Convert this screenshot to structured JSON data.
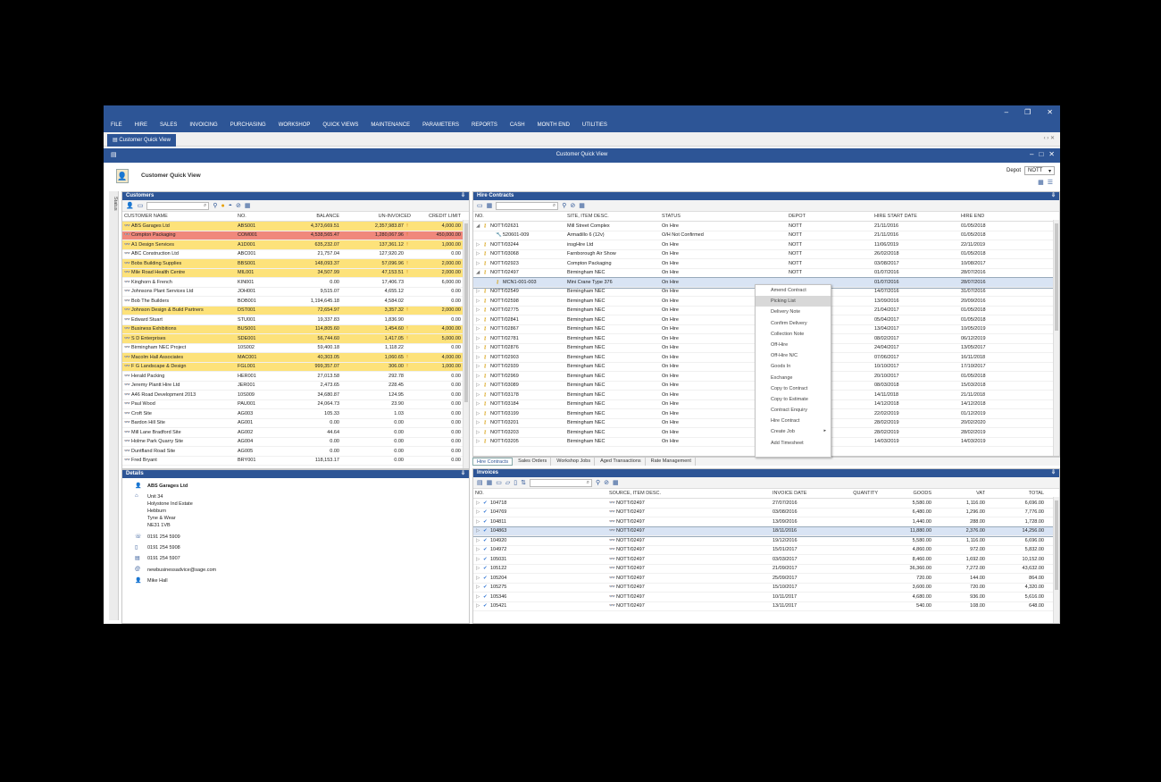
{
  "menu": [
    "FILE",
    "HIRE",
    "SALES",
    "INVOICING",
    "PURCHASING",
    "WORKSHOP",
    "QUICK VIEWS",
    "MAINTENANCE",
    "PARAMETERS",
    "REPORTS",
    "CASH",
    "MONTH END",
    "UTILITIES"
  ],
  "doc_tab": "Customer Quick View",
  "qv_title": "Customer Quick View",
  "page_title": "Customer Quick View",
  "depot_label": "Depot",
  "depot_value": "NOTT",
  "side_tab": "Status",
  "customers": {
    "title": "Customers",
    "columns": [
      "CUSTOMER NAME",
      "NO.",
      "BALANCE",
      "UN-INVOICED",
      "CREDIT LIMIT"
    ],
    "rows": [
      {
        "name": "ABS Garages Ltd",
        "no": "ABS001",
        "balance": "4,373,669.51",
        "uninv": "2,357,983.87",
        "limit": "4,000.00",
        "hl": "yel",
        "flag": "!"
      },
      {
        "name": "Compton Packaging",
        "no": "COM001",
        "balance": "4,538,565.47",
        "uninv": "1,280,067.96",
        "limit": "450,000.00",
        "hl": "red",
        "flag": "!"
      },
      {
        "name": "A1 Design Services",
        "no": "A1D001",
        "balance": "635,232.07",
        "uninv": "137,361.12",
        "limit": "1,000.00",
        "hl": "yel",
        "flag": "!"
      },
      {
        "name": "ABC Construction Ltd",
        "no": "ABC001",
        "balance": "21,757.04",
        "uninv": "127,920.20",
        "limit": "0.00",
        "hl": "",
        "flag": ""
      },
      {
        "name": "Bobs Building Supplies",
        "no": "BBS001",
        "balance": "148,093.37",
        "uninv": "57,096.96",
        "limit": "2,000.00",
        "hl": "yel",
        "flag": "!"
      },
      {
        "name": "Mile Road Health Centre",
        "no": "MIL001",
        "balance": "34,507.99",
        "uninv": "47,153.51",
        "limit": "2,000.00",
        "hl": "yel",
        "flag": "!"
      },
      {
        "name": "Kinghorn & French",
        "no": "KIN001",
        "balance": "0.00",
        "uninv": "17,406.73",
        "limit": "6,000.00",
        "hl": "",
        "flag": ""
      },
      {
        "name": "Johnsons Plant Services Ltd",
        "no": "JOH001",
        "balance": "9,515.07",
        "uninv": "4,655.12",
        "limit": "0.00",
        "hl": "",
        "flag": ""
      },
      {
        "name": "Bob The Builders",
        "no": "BOB001",
        "balance": "1,194,645.18",
        "uninv": "4,584.02",
        "limit": "0.00",
        "hl": "",
        "flag": ""
      },
      {
        "name": "Johnson Design & Build Partners",
        "no": "DST001",
        "balance": "72,654.97",
        "uninv": "3,357.32",
        "limit": "2,000.00",
        "hl": "yel",
        "flag": "!"
      },
      {
        "name": "Edward Stuart",
        "no": "STU001",
        "balance": "19,337.83",
        "uninv": "1,836.90",
        "limit": "0.00",
        "hl": "",
        "flag": ""
      },
      {
        "name": "Business Exhibitions",
        "no": "BUS001",
        "balance": "114,805.60",
        "uninv": "1,454.60",
        "limit": "4,000.00",
        "hl": "yel",
        "flag": "!"
      },
      {
        "name": "S D Enterprises",
        "no": "SDE001",
        "balance": "56,744.60",
        "uninv": "1,417.05",
        "limit": "5,000.00",
        "hl": "yel",
        "flag": "!"
      },
      {
        "name": "Birmingham NEC Project",
        "no": "10S002",
        "balance": "59,400.18",
        "uninv": "1,118.22",
        "limit": "0.00",
        "hl": "",
        "flag": ""
      },
      {
        "name": "Macolm Hall Associates",
        "no": "MAC001",
        "balance": "40,303.05",
        "uninv": "1,060.65",
        "limit": "4,000.00",
        "hl": "yel",
        "flag": "!"
      },
      {
        "name": "F G Landscape & Design",
        "no": "FGL001",
        "balance": "999,357.07",
        "uninv": "306.00",
        "limit": "1,000.00",
        "hl": "yel",
        "flag": "!"
      },
      {
        "name": "Herald Packing",
        "no": "HER001",
        "balance": "27,013.58",
        "uninv": "292.78",
        "limit": "0.00",
        "hl": "",
        "flag": ""
      },
      {
        "name": "Jeremy Plantt Hire Ltd",
        "no": "JER001",
        "balance": "2,473.65",
        "uninv": "228.45",
        "limit": "0.00",
        "hl": "",
        "flag": ""
      },
      {
        "name": "A46 Road Development 2013",
        "no": "10S009",
        "balance": "34,680.87",
        "uninv": "124.95",
        "limit": "0.00",
        "hl": "",
        "flag": ""
      },
      {
        "name": "Paul Wood",
        "no": "PAU001",
        "balance": "24,064.73",
        "uninv": "23.90",
        "limit": "0.00",
        "hl": "",
        "flag": ""
      },
      {
        "name": "Croft Site",
        "no": "AG003",
        "balance": "105.33",
        "uninv": "1.03",
        "limit": "0.00",
        "hl": "",
        "flag": ""
      },
      {
        "name": "Bardon Hill Site",
        "no": "AG001",
        "balance": "0.00",
        "uninv": "0.00",
        "limit": "0.00",
        "hl": "",
        "flag": ""
      },
      {
        "name": "Mill Lane Bradford Site",
        "no": "AG002",
        "balance": "44.64",
        "uninv": "0.00",
        "limit": "0.00",
        "hl": "",
        "flag": ""
      },
      {
        "name": "Holme Park Quarry Site",
        "no": "AG004",
        "balance": "0.00",
        "uninv": "0.00",
        "limit": "0.00",
        "hl": "",
        "flag": ""
      },
      {
        "name": "Duntfland Road Site",
        "no": "AG005",
        "balance": "0.00",
        "uninv": "0.00",
        "limit": "0.00",
        "hl": "",
        "flag": ""
      },
      {
        "name": "Fred Bryant",
        "no": "BRY001",
        "balance": "118,153.17",
        "uninv": "0.00",
        "limit": "0.00",
        "hl": "",
        "flag": ""
      }
    ]
  },
  "details": {
    "title": "Details",
    "company": "ABS Garages Ltd",
    "address": [
      "Unit 34",
      "Holystone Ind Estate",
      "Hebburn",
      "Tyne & Wear",
      "NE31 1VB"
    ],
    "phone1": "0191 254 5909",
    "phone2": "0191 254 5908",
    "fax": "0191 254 5907",
    "email": "newbusinessadvice@sage.com",
    "contact": "Mike Hall"
  },
  "hire": {
    "title": "Hire Contracts",
    "columns": [
      "NO.",
      "SITE, ITEM DESC.",
      "STATUS",
      "DEPOT",
      "HIRE START DATE",
      "HIRE END"
    ],
    "rows": [
      {
        "no": "NOTT/02631",
        "site": "Mill Street Complex",
        "status": "On Hire",
        "depot": "NOTT",
        "start": "21/11/2016",
        "end": "01/05/2018",
        "exp": "◢",
        "icon": "key",
        "indent": 0,
        "sel": false
      },
      {
        "no": "520601-009",
        "site": "Armadillo 6 (12v)",
        "status": "O/H Not Confirmed",
        "depot": "NOTT",
        "start": "21/11/2016",
        "end": "01/05/2018",
        "exp": "",
        "icon": "tool",
        "indent": 1,
        "sel": false
      },
      {
        "no": "NOTT/03244",
        "site": "insgHire Ltd",
        "status": "On Hire",
        "depot": "NOTT",
        "start": "11/06/2019",
        "end": "22/11/2019",
        "exp": "▷",
        "icon": "key",
        "indent": 0,
        "sel": false
      },
      {
        "no": "NOTT/03068",
        "site": "Farnborough Air Show",
        "status": "On Hire",
        "depot": "NOTT",
        "start": "26/02/2018",
        "end": "01/05/2018",
        "exp": "▷",
        "icon": "key",
        "indent": 0,
        "sel": false
      },
      {
        "no": "NOTT/02923",
        "site": "Compton Packaging",
        "status": "On Hire",
        "depot": "NOTT",
        "start": "03/08/2017",
        "end": "10/08/2017",
        "exp": "▷",
        "icon": "key",
        "indent": 0,
        "sel": false
      },
      {
        "no": "NOTT/02497",
        "site": "Birmingham NEC",
        "status": "On Hire",
        "depot": "NOTT",
        "start": "01/07/2016",
        "end": "28/07/2016",
        "exp": "◢",
        "icon": "key",
        "indent": 0,
        "sel": false
      },
      {
        "no": "MCN1-001-003",
        "site": "Mini Crane Type 376",
        "status": "On Hire",
        "depot": "",
        "start": "01/07/2016",
        "end": "28/07/2016",
        "exp": "",
        "icon": "key",
        "indent": 1,
        "sel": true
      },
      {
        "no": "NOTT/02549",
        "site": "Birmingham NEC",
        "status": "On Hire",
        "depot": "",
        "start": "14/07/2016",
        "end": "31/07/2016",
        "exp": "▷",
        "icon": "key",
        "indent": 0,
        "sel": false
      },
      {
        "no": "NOTT/02598",
        "site": "Birmingham NEC",
        "status": "On Hire",
        "depot": "",
        "start": "13/09/2016",
        "end": "20/09/2016",
        "exp": "▷",
        "icon": "key",
        "indent": 0,
        "sel": false
      },
      {
        "no": "NOTT/02775",
        "site": "Birmingham NEC",
        "status": "On Hire",
        "depot": "",
        "start": "21/04/2017",
        "end": "01/05/2018",
        "exp": "▷",
        "icon": "key",
        "indent": 0,
        "sel": false
      },
      {
        "no": "NOTT/02841",
        "site": "Birmingham NEC",
        "status": "On Hire",
        "depot": "",
        "start": "05/04/2017",
        "end": "01/05/2018",
        "exp": "▷",
        "icon": "key",
        "indent": 0,
        "sel": false
      },
      {
        "no": "NOTT/02867",
        "site": "Birmingham NEC",
        "status": "On Hire",
        "depot": "",
        "start": "13/04/2017",
        "end": "10/05/2019",
        "exp": "▷",
        "icon": "key",
        "indent": 0,
        "sel": false
      },
      {
        "no": "NOTT/02781",
        "site": "Birmingham NEC",
        "status": "On Hire",
        "depot": "",
        "start": "08/02/2017",
        "end": "06/12/2019",
        "exp": "▷",
        "icon": "key",
        "indent": 0,
        "sel": false
      },
      {
        "no": "NOTT/02876",
        "site": "Birmingham NEC",
        "status": "On Hire",
        "depot": "",
        "start": "24/04/2017",
        "end": "13/05/2017",
        "exp": "▷",
        "icon": "key",
        "indent": 0,
        "sel": false
      },
      {
        "no": "NOTT/02903",
        "site": "Birmingham NEC",
        "status": "On Hire",
        "depot": "",
        "start": "07/06/2017",
        "end": "16/11/2018",
        "exp": "▷",
        "icon": "key",
        "indent": 0,
        "sel": false
      },
      {
        "no": "NOTT/02939",
        "site": "Birmingham NEC",
        "status": "On Hire",
        "depot": "",
        "start": "10/10/2017",
        "end": "17/10/2017",
        "exp": "▷",
        "icon": "key",
        "indent": 0,
        "sel": false
      },
      {
        "no": "NOTT/02969",
        "site": "Birmingham NEC",
        "status": "On Hire",
        "depot": "",
        "start": "20/10/2017",
        "end": "01/05/2018",
        "exp": "▷",
        "icon": "key",
        "indent": 0,
        "sel": false
      },
      {
        "no": "NOTT/03089",
        "site": "Birmingham NEC",
        "status": "On Hire",
        "depot": "",
        "start": "08/03/2018",
        "end": "15/03/2018",
        "exp": "▷",
        "icon": "key",
        "indent": 0,
        "sel": false
      },
      {
        "no": "NOTT/03178",
        "site": "Birmingham NEC",
        "status": "On Hire",
        "depot": "",
        "start": "14/11/2018",
        "end": "21/11/2018",
        "exp": "▷",
        "icon": "key",
        "indent": 0,
        "sel": false
      },
      {
        "no": "NOTT/03184",
        "site": "Birmingham NEC",
        "status": "On Hire",
        "depot": "",
        "start": "14/12/2018",
        "end": "14/12/2018",
        "exp": "▷",
        "icon": "key",
        "indent": 0,
        "sel": false
      },
      {
        "no": "NOTT/03199",
        "site": "Birmingham NEC",
        "status": "On Hire",
        "depot": "",
        "start": "22/02/2019",
        "end": "01/12/2019",
        "exp": "▷",
        "icon": "key",
        "indent": 0,
        "sel": false
      },
      {
        "no": "NOTT/03201",
        "site": "Birmingham NEC",
        "status": "On Hire",
        "depot": "",
        "start": "28/02/2019",
        "end": "20/02/2020",
        "exp": "▷",
        "icon": "key",
        "indent": 0,
        "sel": false
      },
      {
        "no": "NOTT/03203",
        "site": "Birmingham NEC",
        "status": "On Hire",
        "depot": "",
        "start": "28/02/2019",
        "end": "28/02/2019",
        "exp": "▷",
        "icon": "key",
        "indent": 0,
        "sel": false
      },
      {
        "no": "NOTT/03205",
        "site": "Birmingham NEC",
        "status": "On Hire",
        "depot": "",
        "start": "14/03/2019",
        "end": "14/03/2019",
        "exp": "▷",
        "icon": "key",
        "indent": 0,
        "sel": false
      }
    ]
  },
  "context_menu": [
    "Amend Contract",
    "Picking List",
    "Delivery Note",
    "Confirm Delivery",
    "Collection Note",
    "Off-Hire",
    "Off-Hire N/C",
    "Goods In",
    "Exchange",
    "Copy to Contract",
    "Copy to Estimate",
    "Contract Enquiry",
    "Hire Contract",
    "Create Job",
    "Add Timesheet"
  ],
  "context_highlight": 1,
  "bottom_tabs": [
    "Hire Contracts",
    "Sales Orders",
    "Workshop Jobs",
    "Aged Transactions",
    "Rate Management"
  ],
  "invoices": {
    "title": "Invoices",
    "columns": [
      "NO.",
      "SOURCE, ITEM DESC.",
      "INVOICE DATE",
      "QUANTITY",
      "GOODS",
      "VAT",
      "TOTAL"
    ],
    "rows": [
      {
        "no": "104718",
        "source": "NOTT/02497",
        "date": "27/07/2016",
        "goods": "5,580.00",
        "vat": "1,116.00",
        "total": "6,696.00",
        "sel": false
      },
      {
        "no": "104769",
        "source": "NOTT/02497",
        "date": "03/08/2016",
        "goods": "6,480.00",
        "vat": "1,296.00",
        "total": "7,776.00",
        "sel": false
      },
      {
        "no": "104811",
        "source": "NOTT/02497",
        "date": "13/09/2016",
        "goods": "1,440.00",
        "vat": "288.00",
        "total": "1,728.00",
        "sel": false
      },
      {
        "no": "104863",
        "source": "NOTT/02497",
        "date": "18/11/2016",
        "goods": "11,880.00",
        "vat": "2,376.00",
        "total": "14,256.00",
        "sel": true
      },
      {
        "no": "104920",
        "source": "NOTT/02497",
        "date": "19/12/2016",
        "goods": "5,580.00",
        "vat": "1,116.00",
        "total": "6,696.00",
        "sel": false
      },
      {
        "no": "104972",
        "source": "NOTT/02497",
        "date": "15/01/2017",
        "goods": "4,860.00",
        "vat": "972.00",
        "total": "5,832.00",
        "sel": false
      },
      {
        "no": "105031",
        "source": "NOTT/02497",
        "date": "03/03/2017",
        "goods": "8,460.00",
        "vat": "1,692.00",
        "total": "10,152.00",
        "sel": false
      },
      {
        "no": "105122",
        "source": "NOTT/02497",
        "date": "21/09/2017",
        "goods": "36,360.00",
        "vat": "7,272.00",
        "total": "43,632.00",
        "sel": false
      },
      {
        "no": "105204",
        "source": "NOTT/02497",
        "date": "25/09/2017",
        "goods": "720.00",
        "vat": "144.00",
        "total": "864.00",
        "sel": false
      },
      {
        "no": "105275",
        "source": "NOTT/02497",
        "date": "15/10/2017",
        "goods": "3,600.00",
        "vat": "720.00",
        "total": "4,320.00",
        "sel": false
      },
      {
        "no": "105346",
        "source": "NOTT/02497",
        "date": "10/11/2017",
        "goods": "4,680.00",
        "vat": "936.00",
        "total": "5,616.00",
        "sel": false
      },
      {
        "no": "105421",
        "source": "NOTT/02497",
        "date": "13/11/2017",
        "goods": "540.00",
        "vat": "108.00",
        "total": "648.00",
        "sel": false
      }
    ]
  }
}
